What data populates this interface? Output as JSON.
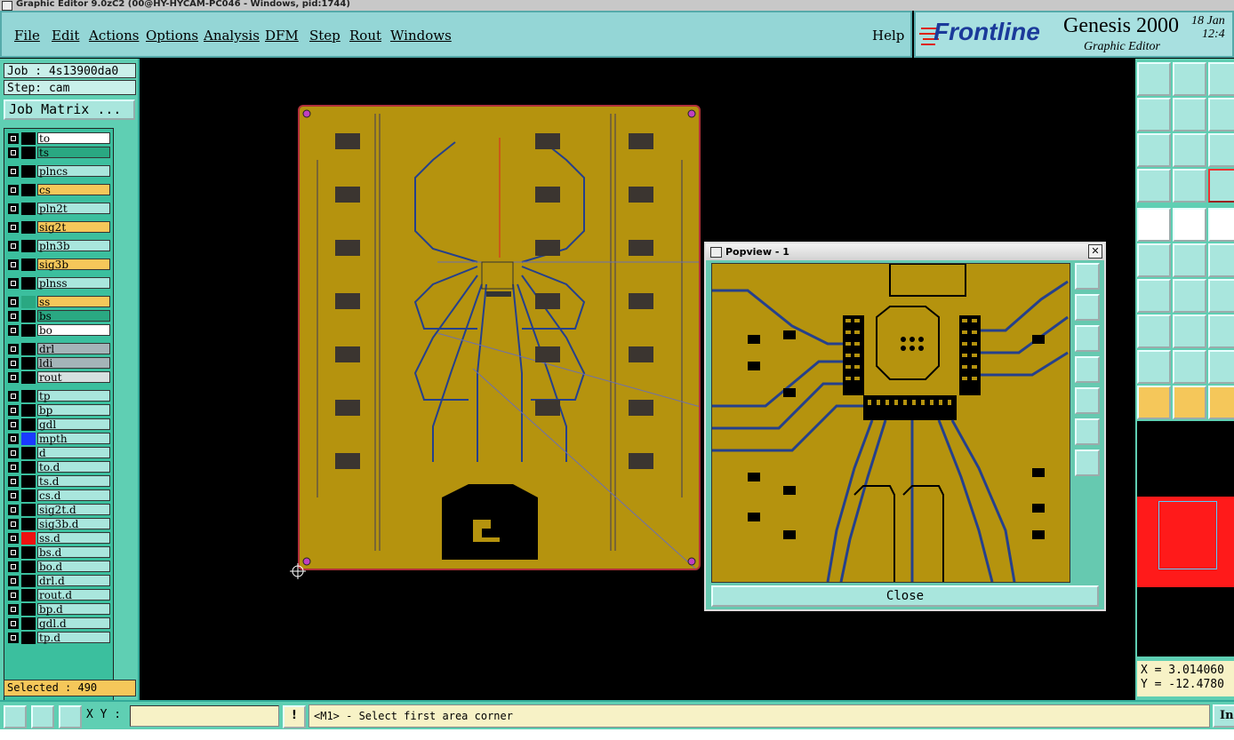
{
  "window": {
    "title": "Graphic Editor 9.0zC2 (00@HY-HYCAM-PC046 - Windows, pid:1744)"
  },
  "menubar": {
    "items": [
      "File",
      "Edit",
      "Actions",
      "Options",
      "Analysis",
      "DFM",
      "Step",
      "Rout",
      "Windows",
      "Help"
    ]
  },
  "brand": {
    "logo": "Frontline",
    "product": "Genesis 2000",
    "subtitle": "Graphic Editor",
    "date": "18 Jan",
    "time": "12:4"
  },
  "job": {
    "job_label": "Job : 4s13900da0",
    "step_label": "Step: cam",
    "matrix_button": "Job Matrix ..."
  },
  "layers": [
    {
      "name": "to",
      "color": "#ffffff",
      "swatch": "#000000"
    },
    {
      "name": "ts",
      "color": "#2aa882",
      "swatch": "#000000"
    },
    {
      "name": "plncs",
      "color": "#a9e6dd",
      "swatch": "#000000"
    },
    {
      "name": "cs",
      "color": "#f5c75a",
      "swatch": "#000000"
    },
    {
      "name": "pln2t",
      "color": "#a9e6dd",
      "swatch": "#000000"
    },
    {
      "name": "sig2t",
      "color": "#f5c75a",
      "swatch": "#000000"
    },
    {
      "name": "pln3b",
      "color": "#a9e6dd",
      "swatch": "#000000"
    },
    {
      "name": "sig3b",
      "color": "#f5c75a",
      "swatch": "#000000"
    },
    {
      "name": "plnss",
      "color": "#a9e6dd",
      "swatch": "#000000"
    },
    {
      "name": "ss",
      "color": "#f5c75a",
      "swatch": "#2aa882"
    },
    {
      "name": "bs",
      "color": "#2aa882",
      "swatch": "#000000"
    },
    {
      "name": "bo",
      "color": "#ffffff",
      "swatch": "#000000"
    },
    {
      "name": "drl",
      "color": "#a4b4b8",
      "swatch": "#000000"
    },
    {
      "name": "ldi",
      "color": "#a4b4b8",
      "swatch": "#000000"
    },
    {
      "name": "rout",
      "color": "#d6e0e0",
      "swatch": "#000000"
    },
    {
      "name": "tp",
      "color": "#a9e6dd",
      "swatch": "#000000"
    },
    {
      "name": "bp",
      "color": "#a9e6dd",
      "swatch": "#000000"
    },
    {
      "name": "gdl",
      "color": "#a9e6dd",
      "swatch": "#000000"
    },
    {
      "name": "mpth",
      "color": "#a9e6dd",
      "swatch": "#1a3aff"
    },
    {
      "name": "d",
      "color": "#a9e6dd",
      "swatch": "#000000"
    },
    {
      "name": "to.d",
      "color": "#a9e6dd",
      "swatch": "#000000"
    },
    {
      "name": "ts.d",
      "color": "#a9e6dd",
      "swatch": "#000000"
    },
    {
      "name": "cs.d",
      "color": "#a9e6dd",
      "swatch": "#000000"
    },
    {
      "name": "sig2t.d",
      "color": "#a9e6dd",
      "swatch": "#000000"
    },
    {
      "name": "sig3b.d",
      "color": "#a9e6dd",
      "swatch": "#000000"
    },
    {
      "name": "ss.d",
      "color": "#a9e6dd",
      "swatch": "#ee1111"
    },
    {
      "name": "bs.d",
      "color": "#a9e6dd",
      "swatch": "#000000"
    },
    {
      "name": "bo.d",
      "color": "#a9e6dd",
      "swatch": "#000000"
    },
    {
      "name": "drl.d",
      "color": "#a9e6dd",
      "swatch": "#000000"
    },
    {
      "name": "rout.d",
      "color": "#a9e6dd",
      "swatch": "#000000"
    },
    {
      "name": "bp.d",
      "color": "#a9e6dd",
      "swatch": "#000000"
    },
    {
      "name": "gdl.d",
      "color": "#a9e6dd",
      "swatch": "#000000"
    },
    {
      "name": "tp.d",
      "color": "#a9e6dd",
      "swatch": "#000000"
    }
  ],
  "selection": {
    "label": "Selected : 490"
  },
  "popview": {
    "title": "Popview - 1",
    "close_label": "Close",
    "close_x": "✕"
  },
  "readout": {
    "x": "X = 3.014060",
    "y": "Y = -12.4780"
  },
  "bottombar": {
    "xy_label": "X Y :",
    "xy_value": "",
    "message": "<M1> - Select first area corner",
    "right_button": "In"
  },
  "colors": {
    "board": "#b5930e",
    "trace": "#25408c",
    "panel": "#5fcfb3",
    "menu": "#94d6d6",
    "highlight": "#ff0000"
  }
}
